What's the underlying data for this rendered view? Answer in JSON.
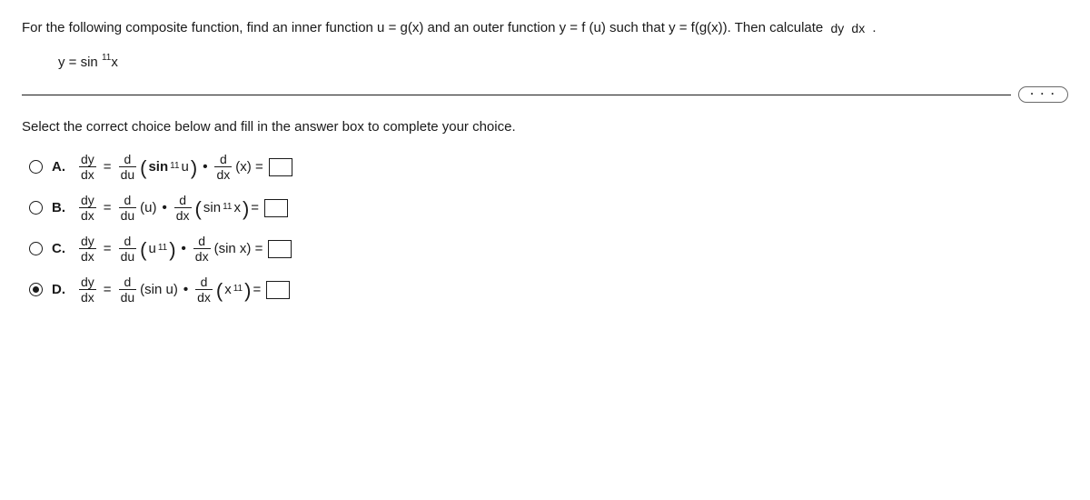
{
  "prompt": {
    "part1": "For the following composite function, find an inner function u = g(x) and an outer function y = f (u) such that y = f(g(x)). Then calculate ",
    "frac_num": "dy",
    "frac_den": "dx",
    "part2": "."
  },
  "equation": {
    "lhs": "y = sin",
    "exp": "11",
    "rhs": "x"
  },
  "dots": "· · ·",
  "instruction": "Select the correct choice below and fill in the answer box to complete your choice.",
  "choices": {
    "A": {
      "label": "A.",
      "dy": "dy",
      "dx": "dx",
      "d": "d",
      "du": "du",
      "f1a": "sin",
      "f1exp": "11",
      "f1b": "u",
      "f2": "(x) ="
    },
    "B": {
      "label": "B.",
      "dy": "dy",
      "dx": "dx",
      "d": "d",
      "du": "du",
      "f1": "(u)",
      "f2a": "sin",
      "f2exp": "11",
      "f2b": "x",
      "eq": " ="
    },
    "C": {
      "label": "C.",
      "dy": "dy",
      "dx": "dx",
      "d": "d",
      "du": "du",
      "f1a": "u",
      "f1exp": "11",
      "f2": "(sin x) ="
    },
    "D": {
      "label": "D.",
      "dy": "dy",
      "dx": "dx",
      "d": "d",
      "du": "du",
      "f1": "(sin u)",
      "f2a": "x",
      "f2exp": "11",
      "eq": " ="
    }
  },
  "chart_data": null
}
